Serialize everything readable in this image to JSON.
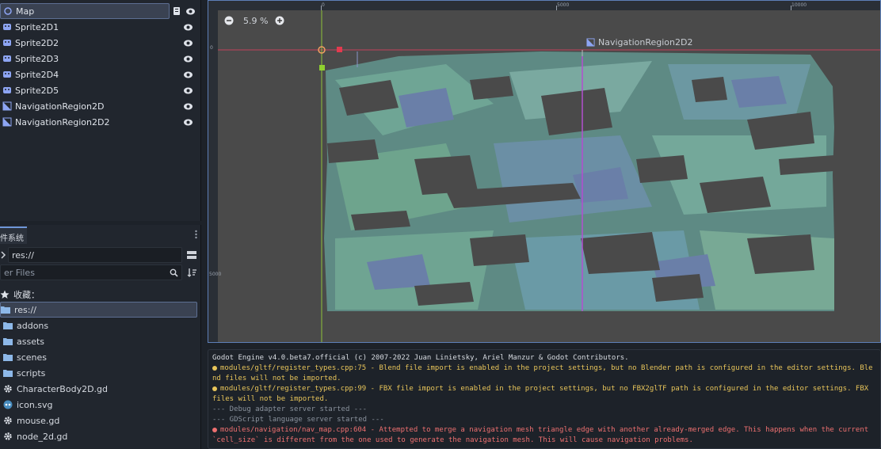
{
  "scene_tree": {
    "items": [
      {
        "label": "Map",
        "icon": "node2d-icon",
        "selected": true
      },
      {
        "label": "Sprite2D1",
        "icon": "sprite2d-icon"
      },
      {
        "label": "Sprite2D2",
        "icon": "sprite2d-icon"
      },
      {
        "label": "Sprite2D3",
        "icon": "sprite2d-icon"
      },
      {
        "label": "Sprite2D4",
        "icon": "sprite2d-icon"
      },
      {
        "label": "Sprite2D5",
        "icon": "sprite2d-icon"
      },
      {
        "label": "NavigationRegion2D",
        "icon": "navigation-region-icon"
      },
      {
        "label": "NavigationRegion2D2",
        "icon": "navigation-region-icon"
      }
    ]
  },
  "filesystem": {
    "tab_label": "件系统",
    "path": "res://",
    "filter_placeholder": "er Files",
    "favorites_label": "收藏：",
    "items": [
      {
        "label": "res://",
        "type": "folder",
        "selected": true
      },
      {
        "label": "addons",
        "type": "folder"
      },
      {
        "label": "assets",
        "type": "folder"
      },
      {
        "label": "scenes",
        "type": "folder"
      },
      {
        "label": "scripts",
        "type": "folder"
      },
      {
        "label": "CharacterBody2D.gd",
        "type": "script"
      },
      {
        "label": "icon.svg",
        "type": "svg"
      },
      {
        "label": "mouse.gd",
        "type": "script"
      },
      {
        "label": "node_2d.gd",
        "type": "script"
      }
    ]
  },
  "viewport": {
    "zoom": "5.9 %",
    "ruler_top": [
      "0",
      "5000",
      "10000"
    ],
    "ruler_left": [
      "0",
      "5000"
    ],
    "node_label": "NavigationRegion2D2"
  },
  "output": {
    "lines": [
      {
        "kind": "info",
        "text": "Godot Engine v4.0.beta7.official (c) 2007-2022 Juan Linietsky, Ariel Manzur & Godot Contributors."
      },
      {
        "kind": "warn",
        "text": "modules/gltf/register_types.cpp:75 - Blend file import is enabled in the project settings, but no Blender path is configured in the editor settings. Blend files will not be imported."
      },
      {
        "kind": "warn",
        "text": "modules/gltf/register_types.cpp:99 - FBX file import is enabled in the project settings, but no FBX2glTF path is configured in the editor settings. FBX files will not be imported."
      },
      {
        "kind": "dim",
        "text": "--- Debug adapter server started ---"
      },
      {
        "kind": "dim",
        "text": "--- GDScript language server started ---"
      },
      {
        "kind": "err",
        "text": "modules/navigation/nav_map.cpp:604 - Attempted to merge a navigation mesh triangle edge with another already-merged edge. This happens when the current `cell_size` is different from the one used to generate the navigation mesh. This will cause navigation problems."
      }
    ]
  },
  "colors": {
    "accent": "#6f97d8",
    "warn": "#e8c55a",
    "error": "#ee7070",
    "mesh_fill": "#6a9a8e"
  }
}
